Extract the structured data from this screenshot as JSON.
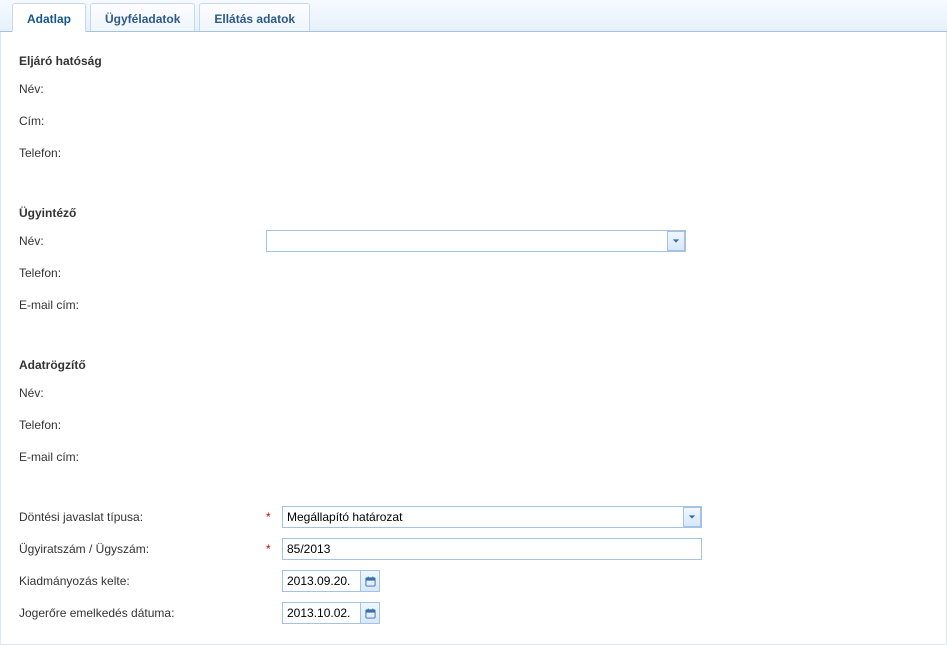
{
  "tabs": [
    {
      "label": "Adatlap"
    },
    {
      "label": "Ügyféladatok"
    },
    {
      "label": "Ellátás adatok"
    }
  ],
  "sections": {
    "authority": {
      "title": "Eljáró hatóság",
      "name_label": "Név:",
      "address_label": "Cím:",
      "phone_label": "Telefon:"
    },
    "admin": {
      "title": "Ügyintéző",
      "name_label": "Név:",
      "phone_label": "Telefon:",
      "email_label": "E-mail cím:",
      "name_value": ""
    },
    "recorder": {
      "title": "Adatrögzítő",
      "name_label": "Név:",
      "phone_label": "Telefon:",
      "email_label": "E-mail cím:"
    },
    "decision": {
      "type_label": "Döntési javaslat típusa:",
      "type_value": "Megállapító határozat",
      "casenum_label": "Ügyiratszám / Ügyszám:",
      "casenum_value": "85/2013",
      "issued_label": "Kiadmányozás kelte:",
      "issued_value": "2013.09.20.",
      "final_label": "Jogerőre emelkedés dátuma:",
      "final_value": "2013.10.02."
    }
  },
  "required_mark": "*"
}
